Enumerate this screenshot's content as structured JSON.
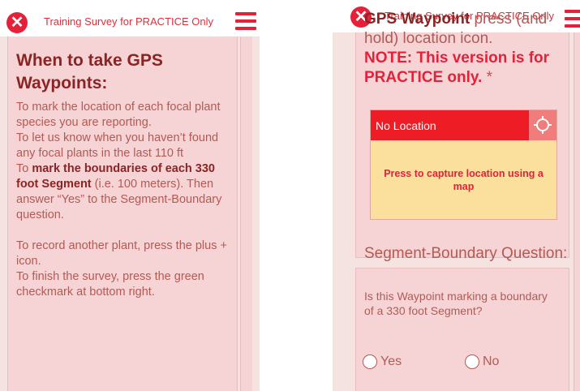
{
  "header": {
    "title": "Training Survey for PRACTICE Only"
  },
  "left": {
    "heading": "When to take GPS Waypoints:",
    "lines": {
      "l1": "To mark the location of each focal plant species you are reporting.",
      "l2": "To let us know when you haven’t found any focal plants in the last 110 ft",
      "l3_pre": "To ",
      "l3_bold": "mark the boundaries of each 330 foot Segment",
      "l3_post": " (i.e. 100 meters). Then answer “Yes” to the Segment-Boundary question.",
      "l4": "To record another plant, press the plus + icon.",
      "l5": "To finish the survey, press the green checkmark at bottom right."
    }
  },
  "right": {
    "gps_question": {
      "strong": "GPS Waypoint",
      "text": " press (and hold) location icon.",
      "note": "NOTE: This version is for PRACTICE only.",
      "required": " *"
    },
    "location": {
      "status": "No Location",
      "capture_text": "Press to capture location using a map"
    },
    "segment": {
      "title": "Segment-Boundary Question:",
      "question": "Is this Waypoint marking a boundary of a 330 foot Segment?",
      "options": [
        "Yes",
        "No"
      ]
    }
  },
  "colors": {
    "accent": "#e5213a",
    "card": "#f6d4d5",
    "text": "#b25a54",
    "heading": "#8b2424",
    "location_bar": "#ee1c25",
    "capture_bg": "#fbdf9d"
  },
  "icons": [
    "close-icon",
    "menu-icon",
    "gps-locate-icon"
  ]
}
